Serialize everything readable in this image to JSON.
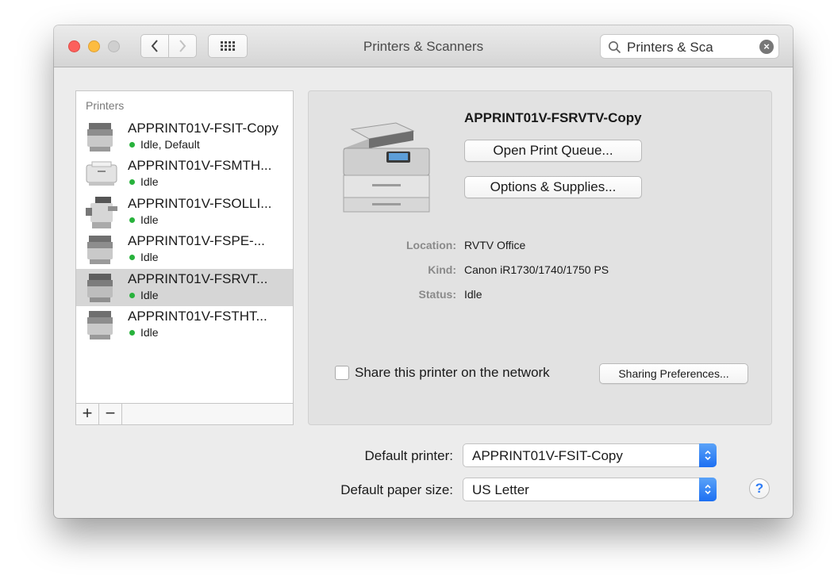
{
  "window": {
    "title": "Printers & Scanners"
  },
  "titlebar": {
    "search": {
      "value": "Printers & Sca"
    },
    "icons": [
      "chevron-left-icon",
      "chevron-right-icon",
      "grid-icon",
      "search-icon",
      "clear-icon"
    ]
  },
  "sidebar": {
    "header": "Printers",
    "items": [
      {
        "name": "APPRINT01V-FSIT-Copy",
        "status": "Idle, Default",
        "selected": false
      },
      {
        "name": "APPRINT01V-FSMTH...",
        "status": "Idle",
        "selected": false
      },
      {
        "name": "APPRINT01V-FSOLLI...",
        "status": "Idle",
        "selected": false
      },
      {
        "name": "APPRINT01V-FSPE-...",
        "status": "Idle",
        "selected": false
      },
      {
        "name": "APPRINT01V-FSRVT...",
        "status": "Idle",
        "selected": true
      },
      {
        "name": "APPRINT01V-FSTHT...",
        "status": "Idle",
        "selected": false
      }
    ],
    "add_label": "+",
    "remove_label": "−"
  },
  "detail": {
    "printer_name": "APPRINT01V-FSRVTV-Copy",
    "open_queue_label": "Open Print Queue...",
    "options_label": "Options & Supplies...",
    "location_label": "Location:",
    "location_value": "RVTV Office",
    "kind_label": "Kind:",
    "kind_value": "Canon iR1730/1740/1750 PS",
    "status_label": "Status:",
    "status_value": "Idle",
    "share_label": "Share this printer on the network",
    "share_checked": false,
    "sharing_prefs_label": "Sharing Preferences..."
  },
  "bottom": {
    "default_printer_label": "Default printer:",
    "default_printer_value": "APPRINT01V-FSIT-Copy",
    "paper_size_label": "Default paper size:",
    "paper_size_value": "US Letter",
    "help_label": "?"
  },
  "colors": {
    "accent": "#2f7cf6",
    "idle_dot": "#28b23c",
    "selected_row": "#d6d6d6"
  }
}
